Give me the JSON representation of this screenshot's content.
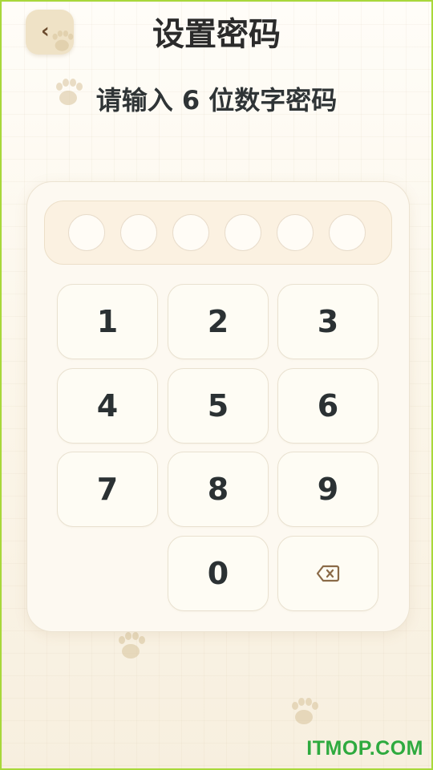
{
  "header": {
    "back_icon": "chevron-left-icon",
    "title": "设置密码"
  },
  "instruction": "请输入 6 位数字密码",
  "pin": {
    "length": 6,
    "entered": 0
  },
  "keypad": {
    "keys": [
      "1",
      "2",
      "3",
      "4",
      "5",
      "6",
      "7",
      "8",
      "9",
      "",
      "0"
    ],
    "backspace_icon": "backspace-icon"
  },
  "watermark": "ITMOP.COM",
  "colors": {
    "background": "#fbf6ea",
    "text": "#2b3133",
    "accent": "#8a6a47",
    "frame": "#a8d83a",
    "watermark": "#2eaa3f"
  }
}
